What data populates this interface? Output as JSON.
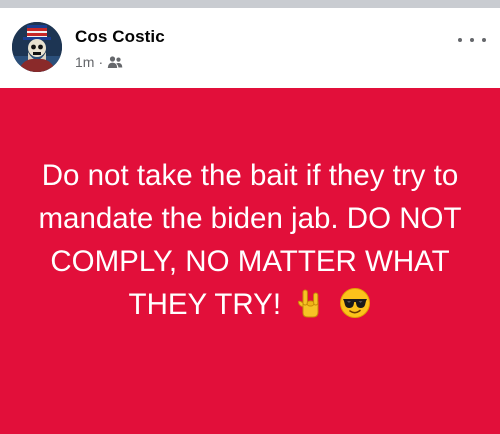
{
  "post": {
    "author": "Cos Costic",
    "timestamp": "1m",
    "separator": "·",
    "audience_icon": "friends-icon",
    "more_icon": "more-options-icon",
    "text": "Do not take the bait if they try to mandate the biden jab. DO NOT COMPLY, NO MATTER WHAT THEY TRY!",
    "emojis": [
      "rock-on-hand-emoji",
      "sunglasses-face-emoji"
    ],
    "background_color": "#e20f3a",
    "text_color": "#ffffff"
  }
}
